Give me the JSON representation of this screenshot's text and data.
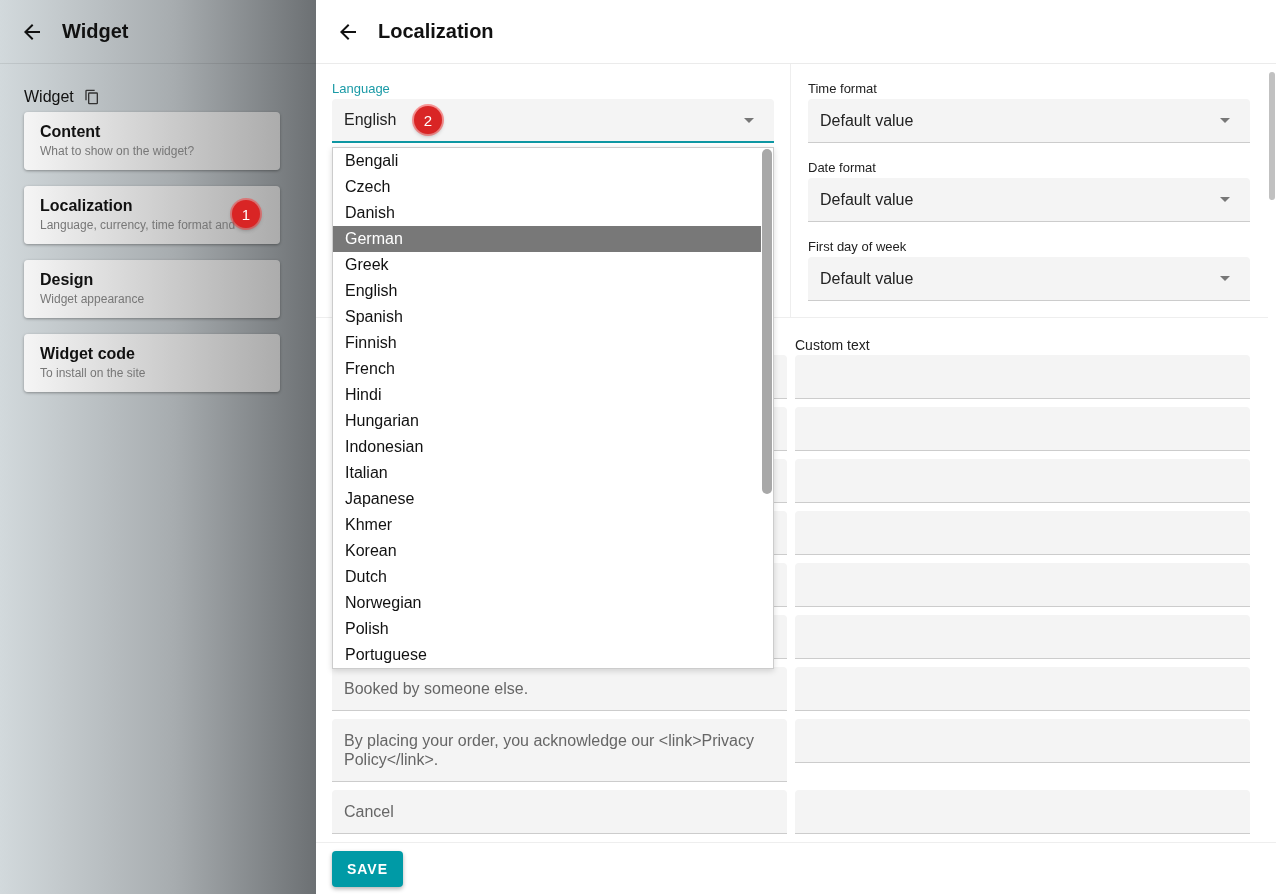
{
  "sidebar": {
    "title": "Widget",
    "section_label": "Widget",
    "items": [
      {
        "title": "Content",
        "subtitle": "What to show on the widget?"
      },
      {
        "title": "Localization",
        "subtitle": "Language, currency, time format and",
        "badge": "1"
      },
      {
        "title": "Design",
        "subtitle": "Widget appearance"
      },
      {
        "title": "Widget code",
        "subtitle": "To install on the site"
      }
    ]
  },
  "panel": {
    "title": "Localization"
  },
  "language": {
    "label": "Language",
    "value": "English",
    "badge": "2",
    "expanded": true,
    "options": [
      {
        "label": "Bengali",
        "highlighted": false
      },
      {
        "label": "Czech",
        "highlighted": false
      },
      {
        "label": "Danish",
        "highlighted": false
      },
      {
        "label": "German",
        "highlighted": true
      },
      {
        "label": "Greek",
        "highlighted": false
      },
      {
        "label": "English",
        "highlighted": false
      },
      {
        "label": "Spanish",
        "highlighted": false
      },
      {
        "label": "Finnish",
        "highlighted": false
      },
      {
        "label": "French",
        "highlighted": false
      },
      {
        "label": "Hindi",
        "highlighted": false
      },
      {
        "label": "Hungarian",
        "highlighted": false
      },
      {
        "label": "Indonesian",
        "highlighted": false
      },
      {
        "label": "Italian",
        "highlighted": false
      },
      {
        "label": "Japanese",
        "highlighted": false
      },
      {
        "label": "Khmer",
        "highlighted": false
      },
      {
        "label": "Korean",
        "highlighted": false
      },
      {
        "label": "Dutch",
        "highlighted": false
      },
      {
        "label": "Norwegian",
        "highlighted": false
      },
      {
        "label": "Polish",
        "highlighted": false
      },
      {
        "label": "Portuguese",
        "highlighted": false
      }
    ]
  },
  "formats": [
    {
      "label": "Time format",
      "value": "Default value"
    },
    {
      "label": "Date format",
      "value": "Default value"
    },
    {
      "label": "First day of week",
      "value": "Default value"
    }
  ],
  "texts": {
    "custom_label": "Custom text",
    "rows": [
      {
        "kind": "single"
      },
      {
        "kind": "single"
      },
      {
        "kind": "single"
      },
      {
        "kind": "single"
      },
      {
        "kind": "single"
      },
      {
        "kind": "single"
      },
      {
        "kind": "single",
        "default_text": "Booked by someone else."
      },
      {
        "kind": "double",
        "default_text": "By placing your order, you acknowledge our <link>Privacy Policy</link>."
      },
      {
        "kind": "single",
        "default_text": "Cancel"
      }
    ]
  },
  "save_button": "SAVE"
}
